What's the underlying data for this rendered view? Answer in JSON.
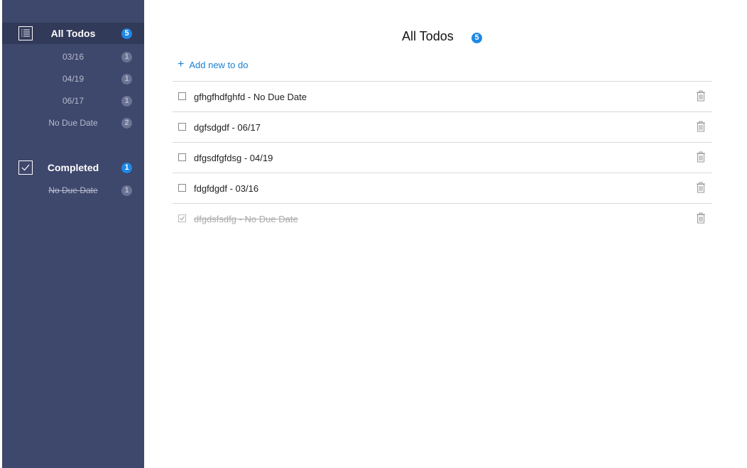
{
  "sidebar": {
    "all_todos": {
      "label": "All Todos",
      "count": "5",
      "items": [
        {
          "label": "03/16",
          "count": "1"
        },
        {
          "label": "04/19",
          "count": "1"
        },
        {
          "label": "06/17",
          "count": "1"
        },
        {
          "label": "No Due Date",
          "count": "2"
        }
      ]
    },
    "completed": {
      "label": "Completed",
      "count": "1",
      "items": [
        {
          "label": "No Due Date",
          "count": "1"
        }
      ]
    }
  },
  "main": {
    "title": "All Todos",
    "count": "5",
    "add_label": "Add new to do",
    "add_icon": "+",
    "todos": [
      {
        "text": "gfhgfhdfghfd - No Due Date",
        "completed": false
      },
      {
        "text": "dgfsdgdf - 06/17",
        "completed": false
      },
      {
        "text": "dfgsdfgfdsg - 04/19",
        "completed": false
      },
      {
        "text": "fdgfdgdf - 03/16",
        "completed": false
      },
      {
        "text": "dfgdsfsdfg - No Due Date",
        "completed": true
      }
    ]
  },
  "colors": {
    "sidebar_bg": "#3e476c",
    "sidebar_active_bg": "#323a5a",
    "accent": "#1e88e5",
    "link": "#1a7fd1"
  }
}
